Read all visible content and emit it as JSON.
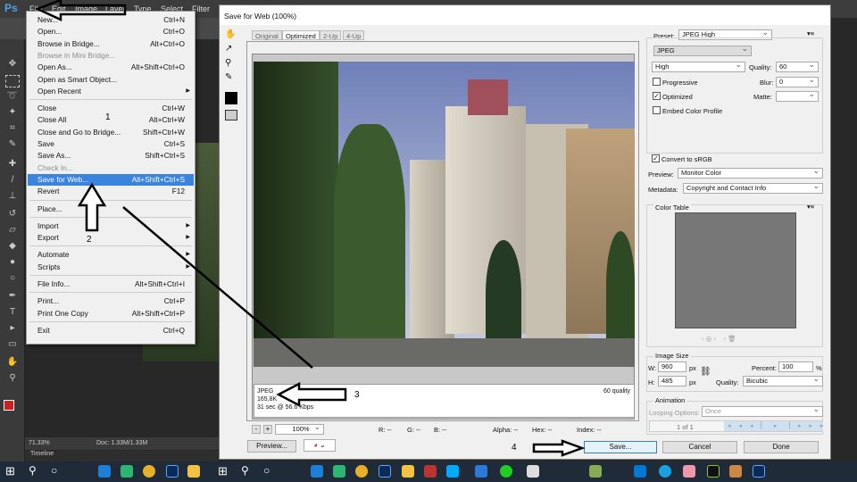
{
  "menubar": {
    "logo": "Ps",
    "items": [
      "File",
      "Edit",
      "Image",
      "Layer",
      "Type",
      "Select",
      "Filter"
    ]
  },
  "file_menu": [
    {
      "label": "New...",
      "shortcut": "Ctrl+N"
    },
    {
      "label": "Open...",
      "shortcut": "Ctrl+O"
    },
    {
      "label": "Browse in Bridge...",
      "shortcut": "Alt+Ctrl+O"
    },
    {
      "label": "Browse in Mini Bridge...",
      "shortcut": "",
      "disabled": true
    },
    {
      "label": "Open As...",
      "shortcut": "Alt+Shift+Ctrl+O"
    },
    {
      "label": "Open as Smart Object...",
      "shortcut": ""
    },
    {
      "label": "Open Recent",
      "shortcut": "",
      "submenu": true
    },
    {
      "label": "Close",
      "shortcut": "Ctrl+W"
    },
    {
      "label": "Close All",
      "shortcut": "Alt+Ctrl+W"
    },
    {
      "label": "Close and Go to Bridge...",
      "shortcut": "Shift+Ctrl+W"
    },
    {
      "label": "Save",
      "shortcut": "Ctrl+S"
    },
    {
      "label": "Save As...",
      "shortcut": "Shift+Ctrl+S"
    },
    {
      "label": "Check In...",
      "shortcut": "",
      "disabled": true
    },
    {
      "label": "Save for Web...",
      "shortcut": "Alt+Shift+Ctrl+S",
      "selected": true
    },
    {
      "label": "Revert",
      "shortcut": "F12"
    },
    {
      "label": "Place...",
      "shortcut": ""
    },
    {
      "label": "Import",
      "shortcut": "",
      "submenu": true
    },
    {
      "label": "Export",
      "shortcut": "",
      "submenu": true
    },
    {
      "label": "Automate",
      "shortcut": "",
      "submenu": true
    },
    {
      "label": "Scripts",
      "shortcut": "",
      "submenu": true
    },
    {
      "label": "File Info...",
      "shortcut": "Alt+Shift+Ctrl+I"
    },
    {
      "label": "Print...",
      "shortcut": "Ctrl+P"
    },
    {
      "label": "Print One Copy",
      "shortcut": "Alt+Shift+Ctrl+P"
    },
    {
      "label": "Exit",
      "shortcut": "Ctrl+Q"
    }
  ],
  "annotations": [
    "1",
    "2",
    "3",
    "4"
  ],
  "ps_status": {
    "zoom": "71.33%",
    "doc": "Doc: 1.33M/1.33M",
    "timeline": "Timeline"
  },
  "dialog": {
    "title": "Save for Web (100%)",
    "tabs": [
      "Original",
      "Optimized",
      "2-Up",
      "4-Up"
    ],
    "info": {
      "format": "JPEG",
      "size": "165,8K",
      "time": "31 sec @ 56.6 Kbps",
      "quality": "60 quality"
    },
    "zoom": "100%",
    "readout": {
      "r": "R: --",
      "g": "G: --",
      "b": "B: --",
      "alpha": "Alpha: --",
      "hex": "Hex: --",
      "index": "Index: --"
    },
    "preview_button": "Preview...",
    "save_button": "Save...",
    "cancel_button": "Cancel",
    "done_button": "Done",
    "settings": {
      "preset_label": "Preset:",
      "preset": "JPEG High",
      "format": "JPEG",
      "compression": "High",
      "quality_label": "Quality:",
      "quality": "60",
      "blur_label": "Blur:",
      "blur": "0",
      "matte_label": "Matte:",
      "matte": "",
      "progressive": {
        "label": "Progressive",
        "checked": false
      },
      "optimized": {
        "label": "Optimized",
        "checked": true
      },
      "embed": {
        "label": "Embed Color Profile",
        "checked": false
      },
      "srgb": {
        "label": "Convert to sRGB",
        "checked": true
      },
      "preview_label": "Preview:",
      "preview": "Monitor Color",
      "metadata_label": "Metadata:",
      "metadata": "Copyright and Contact Info"
    },
    "color_table": "Color Table",
    "image_size": {
      "title": "Image Size",
      "w_label": "W:",
      "w": "960",
      "h_label": "H:",
      "h": "485",
      "unit": "px",
      "percent_label": "Percent:",
      "percent": "100",
      "percent_unit": "%",
      "quality_label": "Quality:",
      "quality": "Bicubic"
    },
    "animation": {
      "title": "Animation",
      "looping_label": "Looping Options:",
      "looping": "Once",
      "frame": "1 of 1"
    }
  }
}
